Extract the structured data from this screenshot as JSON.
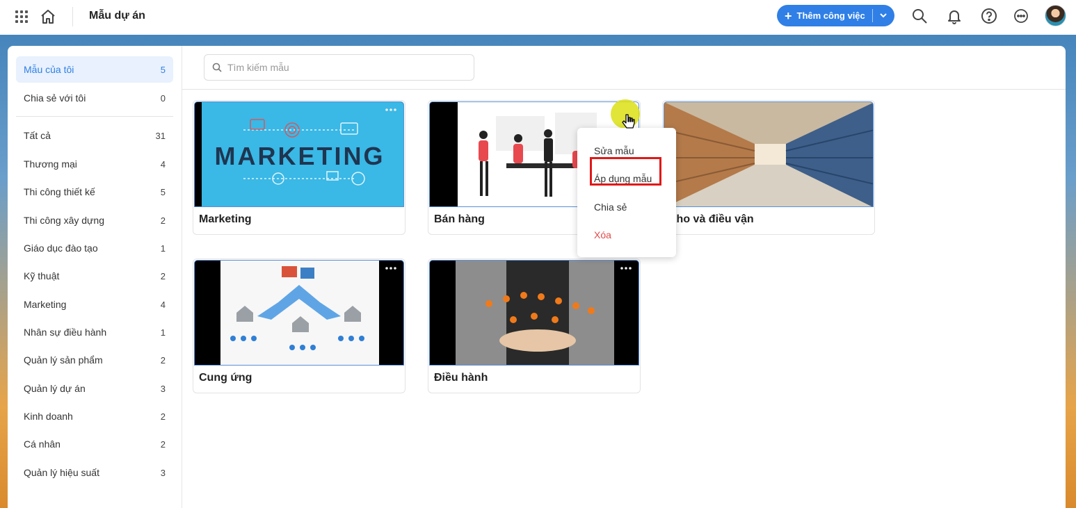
{
  "header": {
    "title": "Mẫu dự án",
    "add_button_label": "Thêm công việc"
  },
  "sidebar": {
    "items": [
      {
        "label": "Mẫu của tôi",
        "count": "5"
      },
      {
        "label": "Chia sẻ với tôi",
        "count": "0"
      },
      {
        "label": "Tất cả",
        "count": "31"
      },
      {
        "label": "Thương mại",
        "count": "4"
      },
      {
        "label": "Thi công thiết kế",
        "count": "5"
      },
      {
        "label": "Thi công xây dựng",
        "count": "2"
      },
      {
        "label": "Giáo dục đào tạo",
        "count": "1"
      },
      {
        "label": "Kỹ thuật",
        "count": "2"
      },
      {
        "label": "Marketing",
        "count": "4"
      },
      {
        "label": "Nhân sự điều hành",
        "count": "1"
      },
      {
        "label": "Quản lý sản phẩm",
        "count": "2"
      },
      {
        "label": "Quản lý dự án",
        "count": "3"
      },
      {
        "label": "Kinh doanh",
        "count": "2"
      },
      {
        "label": "Cá nhân",
        "count": "2"
      },
      {
        "label": "Quản lý hiệu suất",
        "count": "3"
      }
    ]
  },
  "search": {
    "placeholder": "Tìm kiếm mẫu"
  },
  "cards": [
    {
      "title": "Marketing",
      "thumb_text": "MARKETING"
    },
    {
      "title": "Bán hàng"
    },
    {
      "title": "Kho và điều vận"
    },
    {
      "title": "Cung ứng"
    },
    {
      "title": "Điều hành"
    }
  ],
  "menu": {
    "items": [
      {
        "label": "Sửa mẫu"
      },
      {
        "label": "Áp dụng mẫu"
      },
      {
        "label": "Chia sẻ"
      },
      {
        "label": "Xóa"
      }
    ]
  },
  "colors": {
    "accent": "#2f7fe6",
    "danger": "#e04a4a",
    "highlight": "#e01818"
  }
}
